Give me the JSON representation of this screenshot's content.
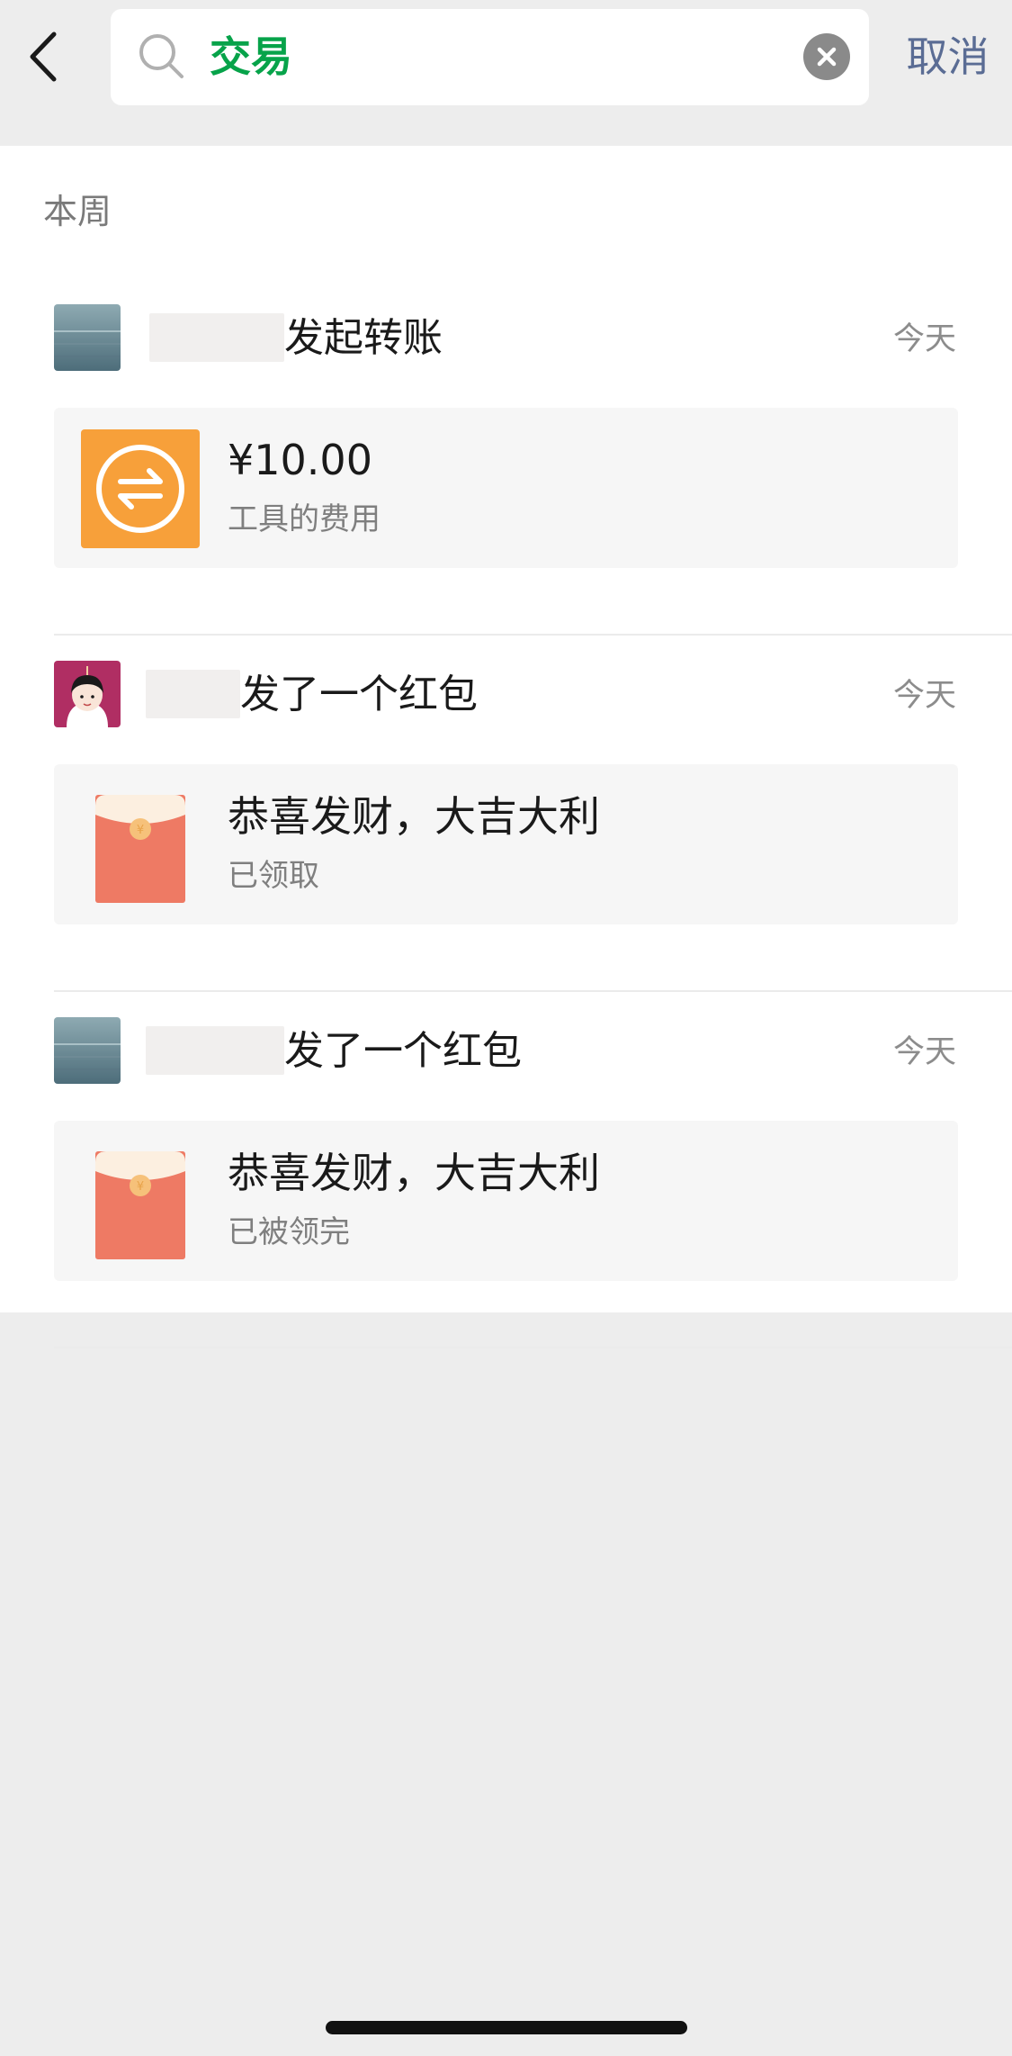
{
  "header": {
    "search_query": "交易",
    "cancel_label": "取消"
  },
  "section": {
    "title": "本周"
  },
  "entries": [
    {
      "title": "发起转账",
      "time": "今天",
      "card_title": "¥10.00",
      "card_sub": "工具的费用",
      "card_icon": "transfer-icon",
      "avatar_icon": "landscape-avatar-icon"
    },
    {
      "title": "发了一个红包",
      "time": "今天",
      "card_title": "恭喜发财，大吉大利",
      "card_sub": "已领取",
      "card_icon": "red-packet-icon",
      "avatar_icon": "cartoon-girl-avatar-icon"
    },
    {
      "title": "发了一个红包",
      "time": "今天",
      "card_title": "恭喜发财，大吉大利",
      "card_sub": "已被领完",
      "card_icon": "red-packet-icon",
      "avatar_icon": "landscape-avatar-icon"
    }
  ],
  "colors": {
    "search_text": "#07a34a",
    "cancel": "#5a6c94",
    "transfer": "#f7a03a",
    "red_packet": "#ee7a64"
  }
}
